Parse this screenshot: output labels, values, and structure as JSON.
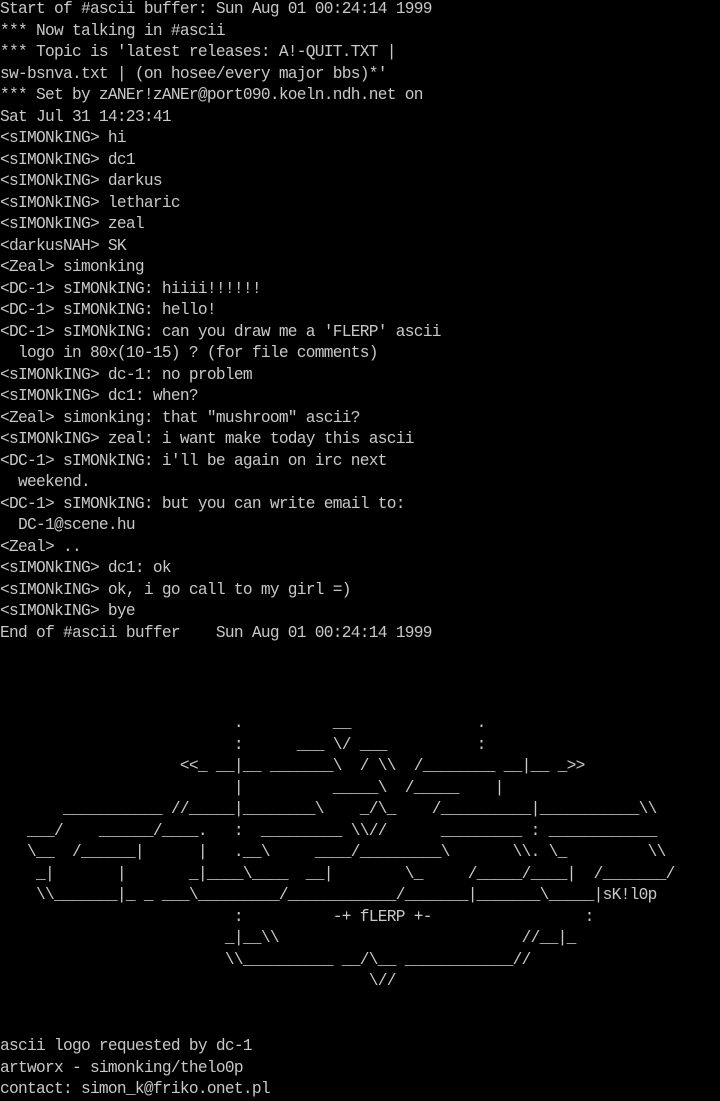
{
  "buffer": {
    "lines": [
      "Start of #ascii buffer: Sun Aug 01 00:24:14 1999",
      "*** Now talking in #ascii",
      "*** Topic is 'latest releases: A!-QUIT.TXT |",
      "sw-bsnva.txt | (on hosee/every major bbs)*'",
      "*** Set by zANEr!zANEr@port090.koeln.ndh.net on",
      "Sat Jul 31 14:23:41",
      "<sIMONkING> hi",
      "<sIMONkING> dc1",
      "<sIMONkING> darkus",
      "<sIMONkING> letharic",
      "<sIMONkING> zeal",
      "<darkusNAH> SK",
      "<Zeal> simonking",
      "<DC-1> sIMONkING: hiiii!!!!!!",
      "<DC-1> sIMONkING: hello!",
      "<DC-1> sIMONkING: can you draw me a 'FLERP' ascii",
      "  logo in 80x(10-15) ? (for file comments)",
      "<sIMONkING> dc-1: no problem",
      "<sIMONkING> dc1: when?",
      "<Zeal> simonking: that \"mushroom\" ascii?",
      "<sIMONkING> zeal: i want make today this ascii",
      "<DC-1> sIMONkING: i'll be again on irc next",
      "  weekend.",
      "<DC-1> sIMONkING: but you can write email to:",
      "  DC-1@scene.hu",
      "<Zeal> ..",
      "<sIMONkING> dc1: ok",
      "<sIMONkING> ok, i go call to my girl =)",
      "<sIMONkING> bye",
      "End of #ascii buffer    Sun Aug 01 00:24:14 1999"
    ]
  },
  "ascii_logo": {
    "lines": [
      "                          .          __              .",
      "                          :      ___ \\/ ___          :",
      "                    <<_ __|__ _______\\  / \\\\  /________ __|__ _>>",
      "                          |          _____\\  /_____    |",
      "       ___________ //_____|________\\    _/\\_    /__________|___________\\\\",
      "   ___/    ______/____.   :  _________ \\\\//      _________ : ____________",
      "   \\__  /______|      |   .__\\     ____/_________\\       \\\\. \\_         \\\\",
      "    _|       |       _|____\\____  __|        \\_     /_____/____|  /_______/",
      "    \\\\_______|_ _ ___\\_________/____________/_______|_______\\_____|sK!l0p",
      "                          :          -+ fLERP +-                 :",
      "                         _|__\\\\                           //__|_",
      "                         \\\\__________ __/\\__ ____________//",
      "                                         \\//"
    ]
  },
  "credits": {
    "lines": [
      "ascii logo requested by dc-1",
      "artworx - simonking/thelo0p",
      "contact: simon_k@friko.onet.pl"
    ]
  }
}
